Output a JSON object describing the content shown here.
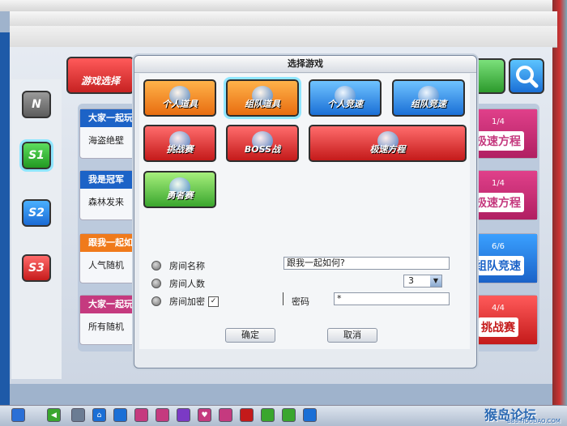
{
  "app": {
    "title": ""
  },
  "left_nav": {
    "servers": [
      {
        "label": "N"
      },
      {
        "label": "S1"
      },
      {
        "label": "S2"
      },
      {
        "label": "S3"
      }
    ],
    "game_select_label": "游戏选择"
  },
  "room_list": [
    {
      "title": "大家一起玩",
      "map": "海盗绝壁",
      "count": "1/4",
      "mode": "极速方程"
    },
    {
      "title": "我是冠军",
      "map": "森林发来",
      "count": "1/4",
      "mode": "极速方程"
    },
    {
      "title": "跟我一起如",
      "map": "人气随机",
      "count": "6/6",
      "mode": "组队竞速"
    },
    {
      "title": "大家一起玩",
      "map": "所有随机",
      "count": "4/4",
      "mode": "挑战赛"
    }
  ],
  "modal": {
    "title": "选择游戏",
    "games": [
      {
        "label": "个人道具",
        "color": "orange"
      },
      {
        "label": "组队道具",
        "color": "orange",
        "selected": true
      },
      {
        "label": "个人竞速",
        "color": "blue"
      },
      {
        "label": "组队竞速",
        "color": "blue"
      },
      {
        "label": "挑战赛",
        "color": "red"
      },
      {
        "label": "BOSS战",
        "color": "red"
      },
      {
        "label": "极速方程",
        "color": "red"
      },
      {
        "label": "勇者赛",
        "color": "green"
      }
    ],
    "form": {
      "room_name_label": "房间名称",
      "room_name_value": "跟我一起如何?",
      "room_size_label": "房间人数",
      "room_size_value": "3",
      "room_lock_label": "房间加密",
      "room_lock_checked_mark": "✓",
      "password_label": "密码",
      "password_value": "*"
    },
    "ok_label": "确定",
    "cancel_label": "取消"
  },
  "taskbar": {
    "watermark_text": "猴岛论坛",
    "watermark_sub": "BBS.HOUDAO.COM"
  },
  "colors": {
    "orange": "#e86d10",
    "blue": "#1a6fd6",
    "red": "#c41a1a",
    "green": "#3aa62e",
    "room_blue": "#1c63c7",
    "room_orange": "#f07a1b",
    "room_pink": "#c53a7f"
  }
}
